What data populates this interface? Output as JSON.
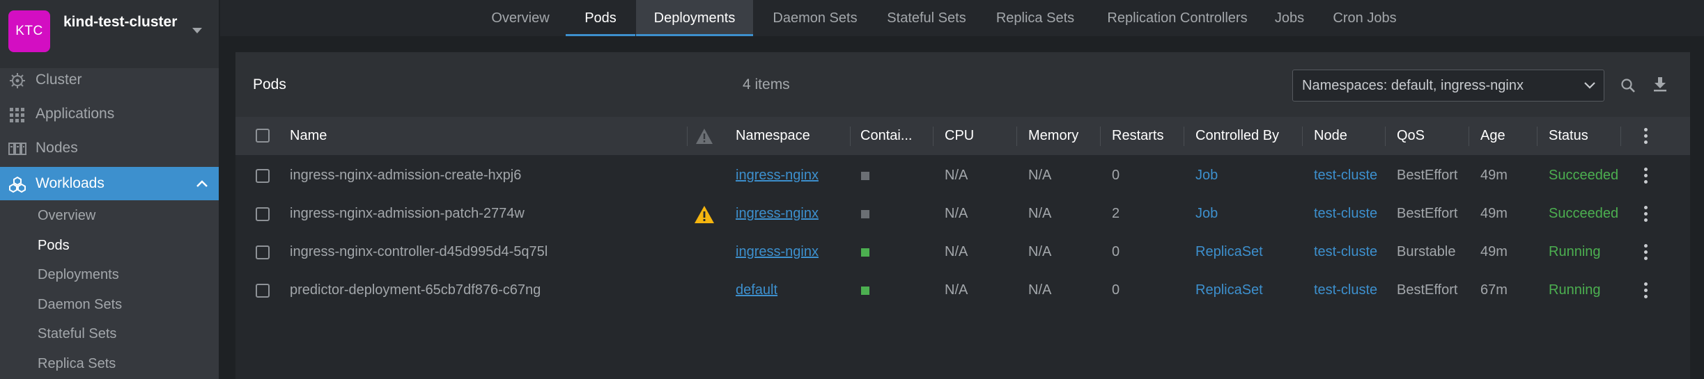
{
  "cluster": {
    "avatar_text": "KTC",
    "avatar_color": "#d30ec2",
    "name": "kind-test-cluster"
  },
  "sidebar": {
    "items": [
      {
        "label": "Cluster",
        "icon": "helm-icon"
      },
      {
        "label": "Applications",
        "icon": "grid-icon"
      },
      {
        "label": "Nodes",
        "icon": "server-icon"
      },
      {
        "label": "Workloads",
        "icon": "workloads-icon",
        "active": true
      }
    ],
    "workloads_sub": [
      {
        "label": "Overview"
      },
      {
        "label": "Pods",
        "active": true
      },
      {
        "label": "Deployments"
      },
      {
        "label": "Daemon Sets"
      },
      {
        "label": "Stateful Sets"
      },
      {
        "label": "Replica Sets"
      }
    ]
  },
  "tabs": [
    {
      "label": "Overview"
    },
    {
      "label": "Pods",
      "active": true
    },
    {
      "label": "Deployments",
      "hover": true
    },
    {
      "label": "Daemon Sets"
    },
    {
      "label": "Stateful Sets"
    },
    {
      "label": "Replica Sets"
    },
    {
      "label": "Replication Controllers"
    },
    {
      "label": "Jobs"
    },
    {
      "label": "Cron Jobs"
    }
  ],
  "panel": {
    "title": "Pods",
    "count": "4 items",
    "namespace_filter": "Namespaces: default, ingress-nginx"
  },
  "table": {
    "columns": {
      "name": "Name",
      "namespace": "Namespace",
      "containers": "Contai...",
      "cpu": "CPU",
      "memory": "Memory",
      "restarts": "Restarts",
      "controlled_by": "Controlled By",
      "node": "Node",
      "qos": "QoS",
      "age": "Age",
      "status": "Status"
    },
    "rows": [
      {
        "name": "ingress-nginx-admission-create-hxpj6",
        "warning": false,
        "namespace": "ingress-nginx",
        "container_state": "terminated",
        "cpu": "N/A",
        "memory": "N/A",
        "restarts": "0",
        "controlled_by": "Job",
        "node": "test-cluste",
        "qos": "BestEffort",
        "age": "49m",
        "status": "Succeeded"
      },
      {
        "name": "ingress-nginx-admission-patch-2774w",
        "warning": true,
        "namespace": "ingress-nginx",
        "container_state": "terminated",
        "cpu": "N/A",
        "memory": "N/A",
        "restarts": "2",
        "controlled_by": "Job",
        "node": "test-cluste",
        "qos": "BestEffort",
        "age": "49m",
        "status": "Succeeded"
      },
      {
        "name": "ingress-nginx-controller-d45d995d4-5q75l",
        "warning": false,
        "namespace": "ingress-nginx",
        "container_state": "running",
        "cpu": "N/A",
        "memory": "N/A",
        "restarts": "0",
        "controlled_by": "ReplicaSet",
        "node": "test-cluste",
        "qos": "Burstable",
        "age": "49m",
        "status": "Running"
      },
      {
        "name": "predictor-deployment-65cb7df876-c67ng",
        "warning": false,
        "namespace": "default",
        "container_state": "running",
        "cpu": "N/A",
        "memory": "N/A",
        "restarts": "0",
        "controlled_by": "ReplicaSet",
        "node": "test-cluste",
        "qos": "BestEffort",
        "age": "67m",
        "status": "Running"
      }
    ]
  },
  "colors": {
    "accent": "#3d90ce",
    "success": "#4caf50",
    "warning": "#f5b50f",
    "container_running": "#4caf50",
    "container_terminated": "#6b6f74"
  }
}
